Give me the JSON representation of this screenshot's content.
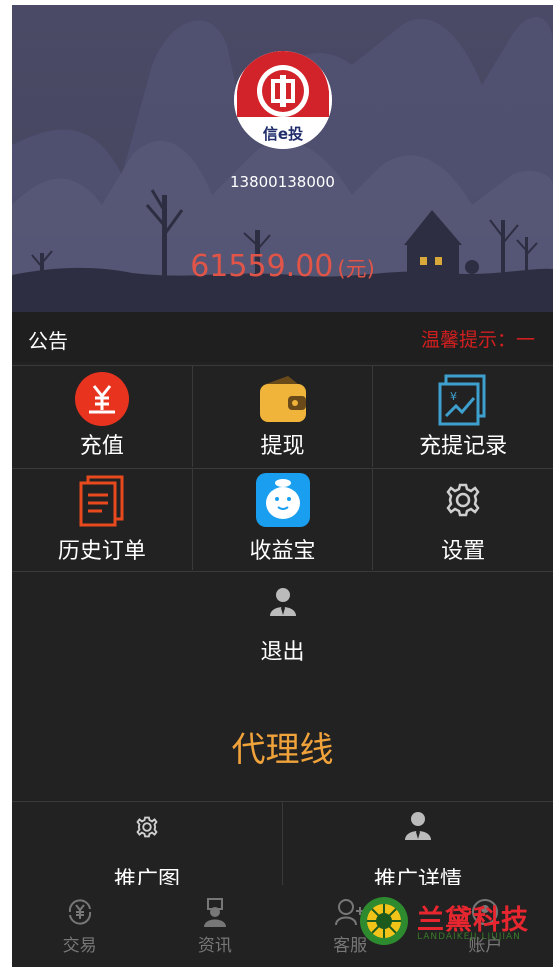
{
  "profile": {
    "phone": "13800138000",
    "balance": "61559.00",
    "balance_unit": "(元)",
    "logo_text": "信e投"
  },
  "notice": {
    "label": "公告",
    "tip": "温馨提示：一"
  },
  "menu": {
    "row1": [
      {
        "label": "充值",
        "icon": "recharge-yen-icon"
      },
      {
        "label": "提现",
        "icon": "wallet-icon"
      },
      {
        "label": "充提记录",
        "icon": "records-icon"
      }
    ],
    "row2": [
      {
        "label": "历史订单",
        "icon": "order-list-icon"
      },
      {
        "label": "收益宝",
        "icon": "mascot-icon"
      },
      {
        "label": "设置",
        "icon": "gear-icon"
      }
    ],
    "logout": {
      "label": "退出",
      "icon": "user-icon"
    }
  },
  "agent": {
    "title": "代理线",
    "items": [
      {
        "label": "推广图",
        "icon": "gear-icon"
      },
      {
        "label": "推广详情",
        "icon": "user-icon"
      }
    ]
  },
  "tabbar": [
    {
      "label": "交易",
      "icon": "yen-cycle-icon"
    },
    {
      "label": "资讯",
      "icon": "news-person-icon"
    },
    {
      "label": "客服",
      "icon": "support-icon"
    },
    {
      "label": "账户",
      "icon": "account-icon"
    }
  ],
  "watermark": {
    "cn": "兰黛科技",
    "en": "LANDAIKEJI.LIUJIAN"
  },
  "colors": {
    "balance": "#e05548",
    "agent_title": "#f0a23b",
    "notice_tip": "#d11f1f",
    "background": "#222222"
  }
}
